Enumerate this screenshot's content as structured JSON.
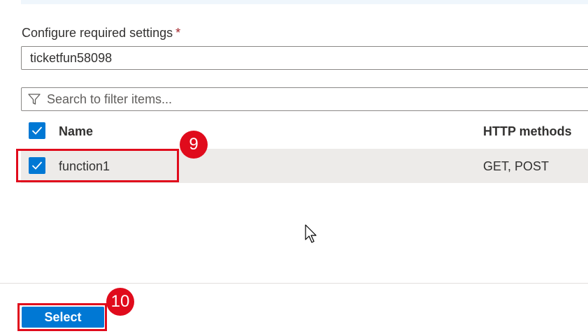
{
  "form": {
    "label": "Configure required settings",
    "required_marker": "*",
    "app_name_value": "ticketfun58098"
  },
  "search": {
    "placeholder": "Search to filter items...",
    "icon": "filter-icon"
  },
  "table": {
    "columns": [
      "Name",
      "HTTP methods"
    ],
    "select_all_checked": true,
    "rows": [
      {
        "name": "function1",
        "methods": "GET, POST",
        "checked": true
      }
    ]
  },
  "annotations": {
    "step_9": "9",
    "step_10": "10"
  },
  "footer": {
    "select_label": "Select"
  },
  "colors": {
    "accent": "#0078d4",
    "annotation_red": "#e00b1c",
    "required_red": "#a4262c",
    "row_selected_bg": "#edebe9"
  }
}
